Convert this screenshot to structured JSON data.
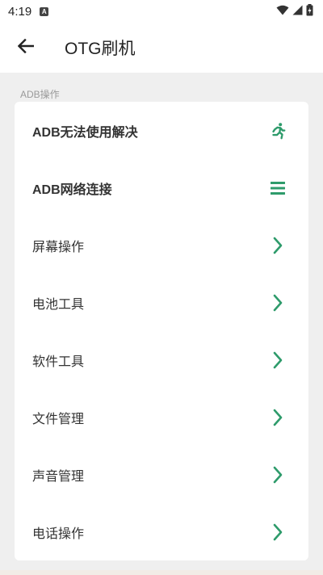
{
  "status": {
    "time": "4:19",
    "notification_badge": "A"
  },
  "appbar": {
    "title": "OTG刷机"
  },
  "section": {
    "label": "ADB操作"
  },
  "rows": [
    {
      "label": "ADB无法使用解决",
      "icon": "run-icon"
    },
    {
      "label": "ADB网络连接",
      "icon": "menu-icon"
    },
    {
      "label": "屏幕操作",
      "icon": "chevron-right-icon"
    },
    {
      "label": "电池工具",
      "icon": "chevron-right-icon"
    },
    {
      "label": "软件工具",
      "icon": "chevron-right-icon"
    },
    {
      "label": "文件管理",
      "icon": "chevron-right-icon"
    },
    {
      "label": "声音管理",
      "icon": "chevron-right-icon"
    },
    {
      "label": "电话操作",
      "icon": "chevron-right-icon"
    }
  ],
  "colors": {
    "accent": "#2e9b6b",
    "background": "#efefef",
    "card": "#ffffff"
  }
}
